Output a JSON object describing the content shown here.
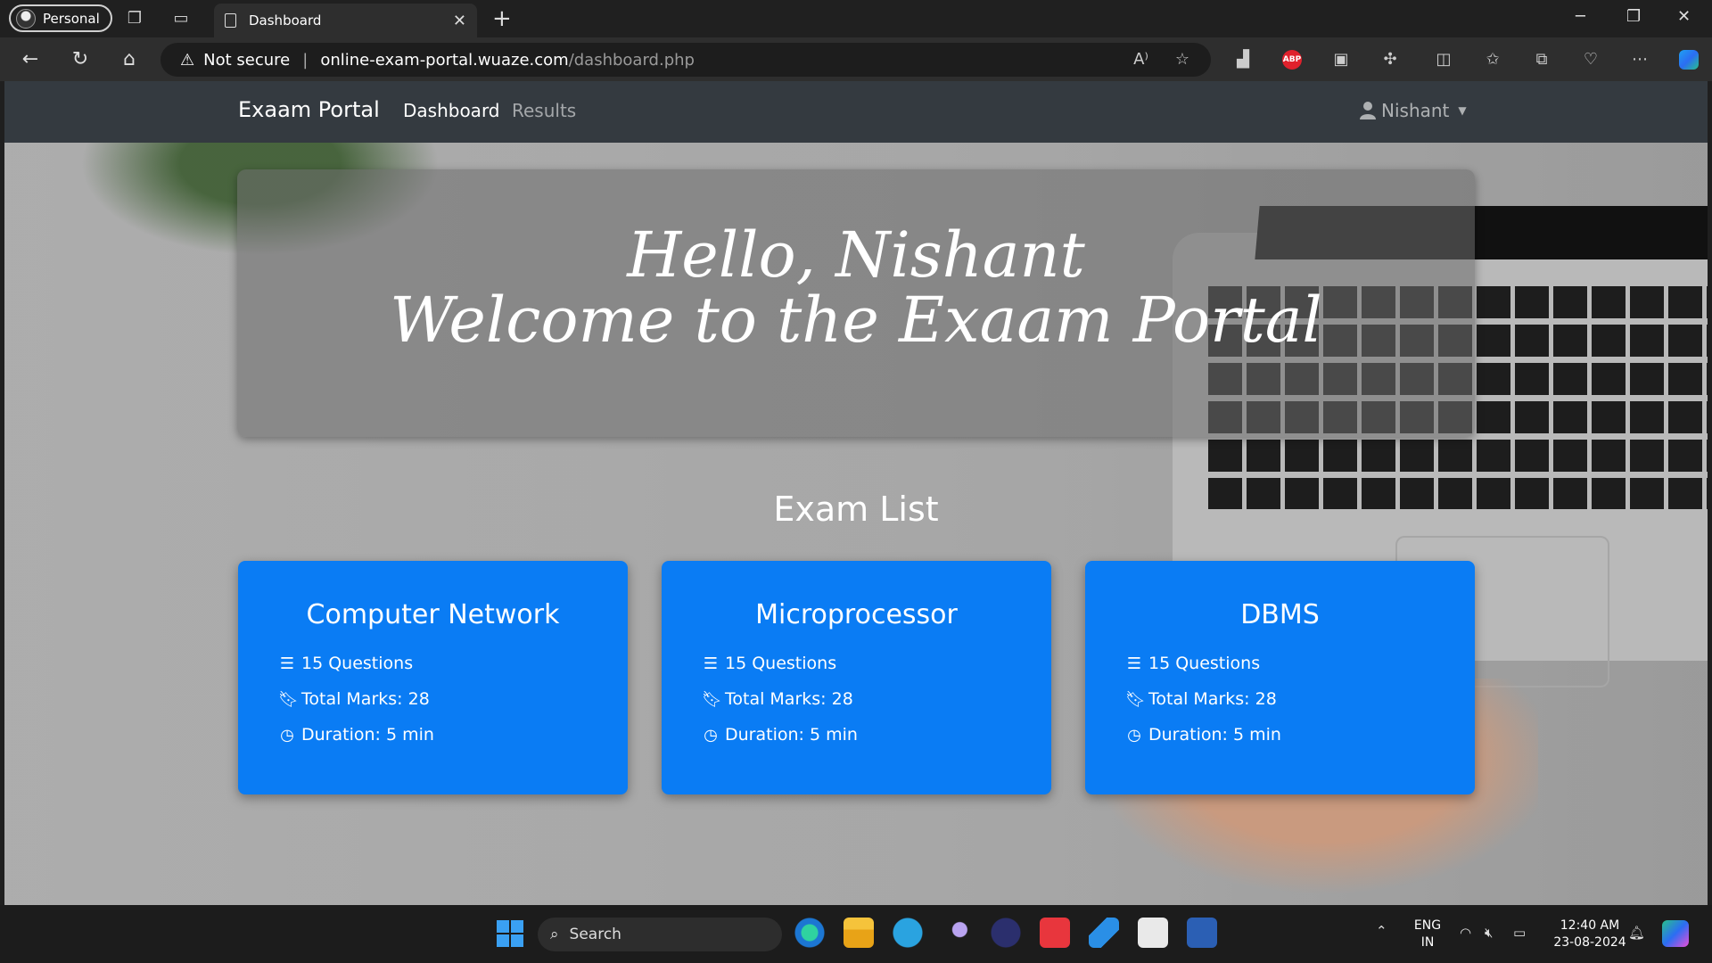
{
  "browser": {
    "profile_label": "Personal",
    "tab_title": "Dashboard",
    "address": {
      "security_label": "Not secure",
      "host": "online-exam-portal.wuaze.com",
      "path": "/dashboard.php"
    },
    "abp_label": "ABP"
  },
  "nav": {
    "brand": "Exaam Portal",
    "links": [
      {
        "label": "Dashboard"
      },
      {
        "label": "Results"
      }
    ],
    "user": "Nishant"
  },
  "hero": {
    "line1": "Hello, Nishant",
    "line2": "Welcome to the Exaam Portal"
  },
  "exam_list_title": "Exam List",
  "exams": [
    {
      "name": "Computer Network",
      "questions": "15 Questions",
      "marks": "Total Marks: 28",
      "duration": "Duration: 5 min"
    },
    {
      "name": "Microprocessor",
      "questions": "15 Questions",
      "marks": "Total Marks: 28",
      "duration": "Duration: 5 min"
    },
    {
      "name": "DBMS",
      "questions": "15 Questions",
      "marks": "Total Marks: 28",
      "duration": "Duration: 5 min"
    }
  ],
  "taskbar": {
    "search_placeholder": "Search",
    "lang_top": "ENG",
    "lang_bottom": "IN",
    "time": "12:40 AM",
    "date": "23-08-2024"
  },
  "colors": {
    "card": "#0a7cf4",
    "navbar": "#343a40"
  }
}
